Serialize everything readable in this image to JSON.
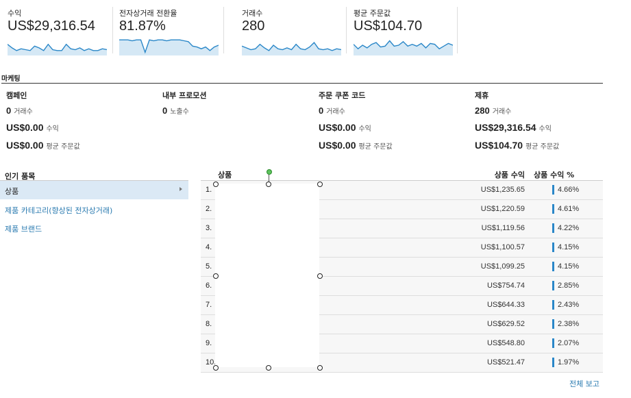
{
  "metrics": [
    {
      "label": "수익",
      "value": "US$29,316.54",
      "spark": [
        0.55,
        0.35,
        0.2,
        0.3,
        0.25,
        0.2,
        0.45,
        0.35,
        0.2,
        0.55,
        0.25,
        0.2,
        0.2,
        0.55,
        0.3,
        0.25,
        0.35,
        0.2,
        0.3,
        0.2,
        0.2,
        0.3,
        0.25
      ]
    },
    {
      "label": "전자상거래 전환율",
      "value": "81.87%",
      "spark": [
        0.8,
        0.8,
        0.8,
        0.75,
        0.8,
        0.8,
        0.1,
        0.8,
        0.75,
        0.8,
        0.8,
        0.75,
        0.8,
        0.8,
        0.8,
        0.75,
        0.7,
        0.45,
        0.4,
        0.3,
        0.4,
        0.2,
        0.4,
        0.5
      ]
    },
    {
      "label": "거래수",
      "value": "280",
      "spark": [
        0.45,
        0.35,
        0.25,
        0.3,
        0.55,
        0.35,
        0.2,
        0.5,
        0.3,
        0.25,
        0.35,
        0.25,
        0.55,
        0.3,
        0.25,
        0.4,
        0.65,
        0.3,
        0.25,
        0.3,
        0.2,
        0.3,
        0.25
      ]
    },
    {
      "label": "평균 주문값",
      "value": "US$104.70",
      "spark": [
        0.55,
        0.3,
        0.5,
        0.35,
        0.55,
        0.65,
        0.4,
        0.45,
        0.75,
        0.45,
        0.5,
        0.7,
        0.45,
        0.55,
        0.45,
        0.6,
        0.35,
        0.6,
        0.55,
        0.3,
        0.45,
        0.6,
        0.5
      ]
    }
  ],
  "marketing": {
    "title": "마케팅",
    "columns": [
      {
        "header": "캠페인",
        "rows": [
          {
            "value": "0",
            "unit": "거래수"
          },
          {
            "value": "US$0.00",
            "unit": "수익"
          },
          {
            "value": "US$0.00",
            "unit": "평균 주문값"
          }
        ]
      },
      {
        "header": "내부 프로모션",
        "rows": [
          {
            "value": "0",
            "unit": "노출수"
          }
        ]
      },
      {
        "header": "주문 쿠폰 코드",
        "rows": [
          {
            "value": "0",
            "unit": "거래수"
          },
          {
            "value": "US$0.00",
            "unit": "수익"
          },
          {
            "value": "US$0.00",
            "unit": "평균 주문값"
          }
        ]
      },
      {
        "header": "제휴",
        "rows": [
          {
            "value": "280",
            "unit": "거래수"
          },
          {
            "value": "US$29,316.54",
            "unit": "수익"
          },
          {
            "value": "US$104.70",
            "unit": "평균 주문값"
          }
        ]
      }
    ]
  },
  "popular": {
    "title": "인기 품목",
    "items": [
      "상품",
      "제품 카테고리(향상된 전자상거래)",
      "제품 브랜드"
    ]
  },
  "table": {
    "col_product": "상품",
    "col_revenue": "상품 수익",
    "col_pct": "상품 수익 %",
    "rows": [
      {
        "num": "1.",
        "revenue": "US$1,235.65",
        "pct": "4.66%"
      },
      {
        "num": "2.",
        "revenue": "US$1,220.59",
        "pct": "4.61%"
      },
      {
        "num": "3.",
        "revenue": "US$1,119.56",
        "pct": "4.22%"
      },
      {
        "num": "4.",
        "revenue": "US$1,100.57",
        "pct": "4.15%"
      },
      {
        "num": "5.",
        "revenue": "US$1,099.25",
        "pct": "4.15%"
      },
      {
        "num": "6.",
        "revenue": "US$754.74",
        "pct": "2.85%"
      },
      {
        "num": "7.",
        "revenue": "US$644.33",
        "pct": "2.43%"
      },
      {
        "num": "8.",
        "revenue": "US$629.52",
        "pct": "2.38%"
      },
      {
        "num": "9.",
        "revenue": "US$548.80",
        "pct": "2.07%"
      },
      {
        "num": "10.",
        "revenue": "US$521.47",
        "pct": "1.97%"
      }
    ]
  },
  "footer": {
    "report_link": "전체 보고"
  },
  "colors": {
    "accent": "#2a87c8",
    "link": "#2a7ab0",
    "spark_fill": "#d5e8f5",
    "active_row": "#dbe9f5"
  }
}
